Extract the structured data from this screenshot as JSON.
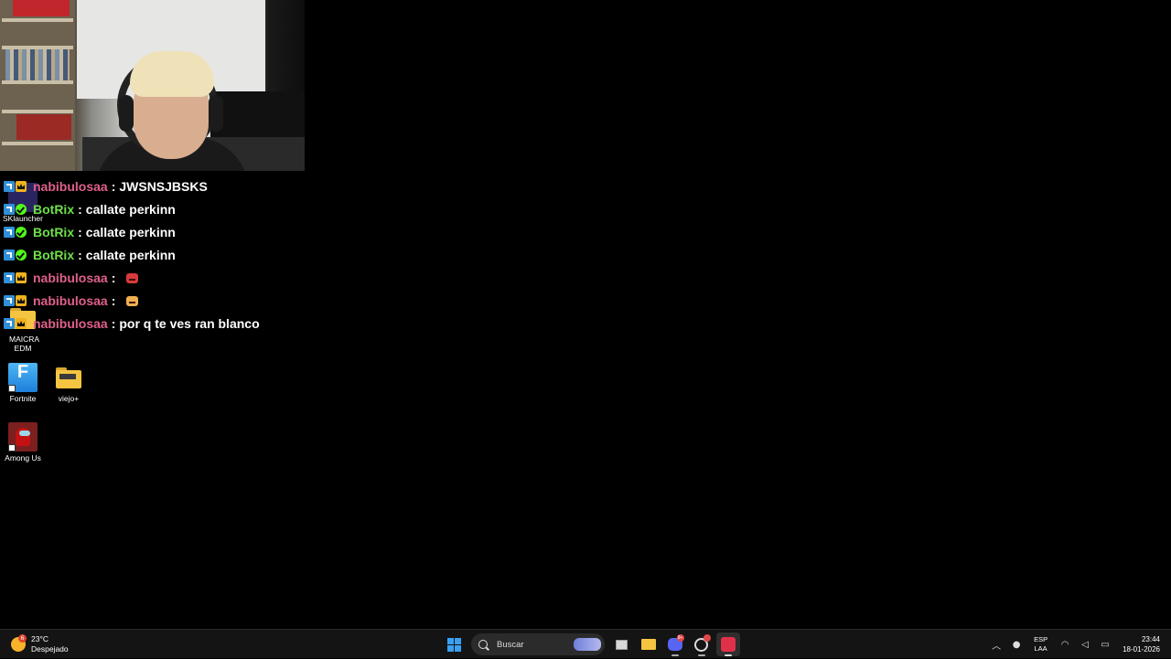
{
  "chat": {
    "messages": [
      {
        "user": "nabibulosaa",
        "color": "#e0608a",
        "badges": [
          "mod-icon",
          "crown-icon"
        ],
        "text": "JWSNSJBSKS"
      },
      {
        "user": "BotRix",
        "color": "#6ee049",
        "badges": [
          "mod-icon",
          "verified-icon"
        ],
        "text": "callate perkinn"
      },
      {
        "user": "BotRix",
        "color": "#6ee049",
        "badges": [
          "mod-icon",
          "verified-icon"
        ],
        "text": "callate perkinn"
      },
      {
        "user": "BotRix",
        "color": "#6ee049",
        "badges": [
          "mod-icon",
          "verified-icon"
        ],
        "text": "callate perkinn"
      },
      {
        "user": "nabibulosaa",
        "color": "#e0608a",
        "badges": [
          "mod-icon",
          "crown-icon"
        ],
        "text": "",
        "emote": "angry-emote-icon"
      },
      {
        "user": "nabibulosaa",
        "color": "#e0608a",
        "badges": [
          "mod-icon",
          "crown-icon"
        ],
        "text": "",
        "emote": "laughing-emote-icon"
      },
      {
        "user": "nabibulosaa",
        "color": "#e0608a",
        "badges": [
          "mod-icon",
          "crown-icon"
        ],
        "text": "por q te ves ran blanco"
      }
    ],
    "separator": ":"
  },
  "desktop": {
    "icons": [
      {
        "label": "SKlauncher",
        "icon": "sklauncher-icon"
      },
      {
        "label": "MAICRA EDM",
        "icon": "folder-icon"
      },
      {
        "label": "Fortnite",
        "icon": "fortnite-icon"
      },
      {
        "label": "viejo+",
        "icon": "folder-icon"
      },
      {
        "label": "Among Us",
        "icon": "among-us-icon"
      }
    ]
  },
  "taskbar": {
    "weather": {
      "temp": "23°C",
      "condition": "Despejado",
      "badge": "6"
    },
    "search_placeholder": "Buscar",
    "discord_badge": "9+",
    "lang_line1": "ESP",
    "lang_line2": "LAA",
    "time": "23:44",
    "date": "18-01-2026"
  },
  "colors": {
    "taskbar_bg": "#141414",
    "accent": "#3aa0f3"
  }
}
